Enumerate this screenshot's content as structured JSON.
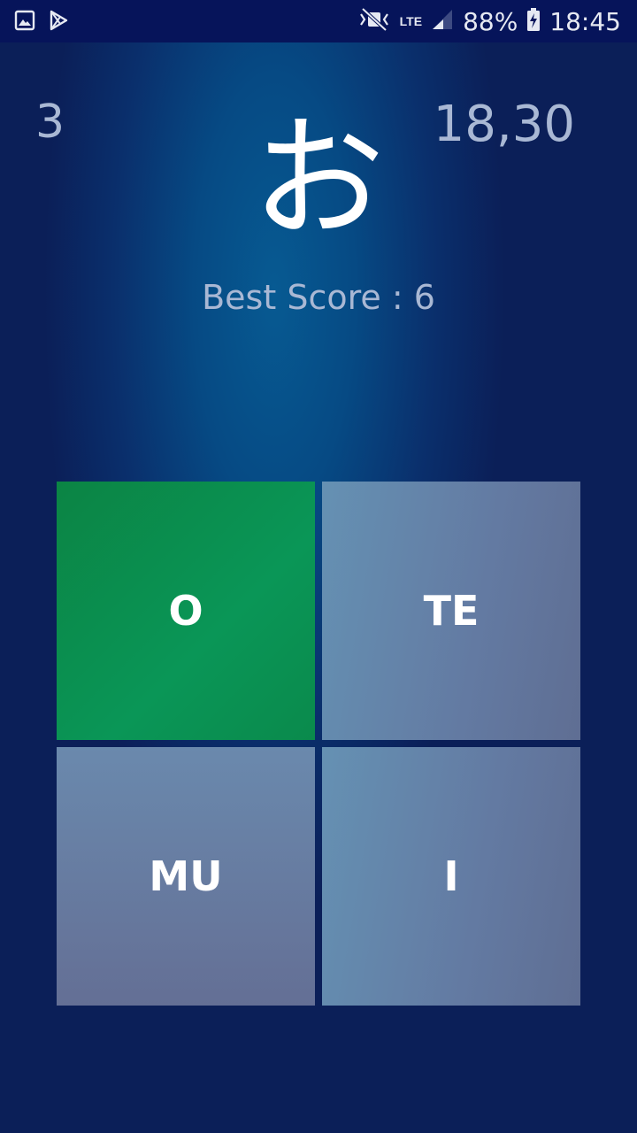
{
  "status_bar": {
    "battery": "88%",
    "time": "18:45",
    "network": "LTE",
    "icons": [
      "gallery-icon",
      "play-store-icon",
      "mute-icon",
      "signal-icon",
      "battery-charging-icon"
    ]
  },
  "game": {
    "streak": "3",
    "timer": "18,30",
    "kana": "お",
    "best_score": "Best Score : 6"
  },
  "answers": [
    {
      "label": "O",
      "state": "correct"
    },
    {
      "label": "TE",
      "state": "neutral"
    },
    {
      "label": "MU",
      "state": "neutral"
    },
    {
      "label": "I",
      "state": "neutral"
    }
  ],
  "colors": {
    "correct": "#0a9150",
    "neutral": "#6385aa",
    "background": "#0b1f58",
    "status_bar": "#06145a"
  }
}
